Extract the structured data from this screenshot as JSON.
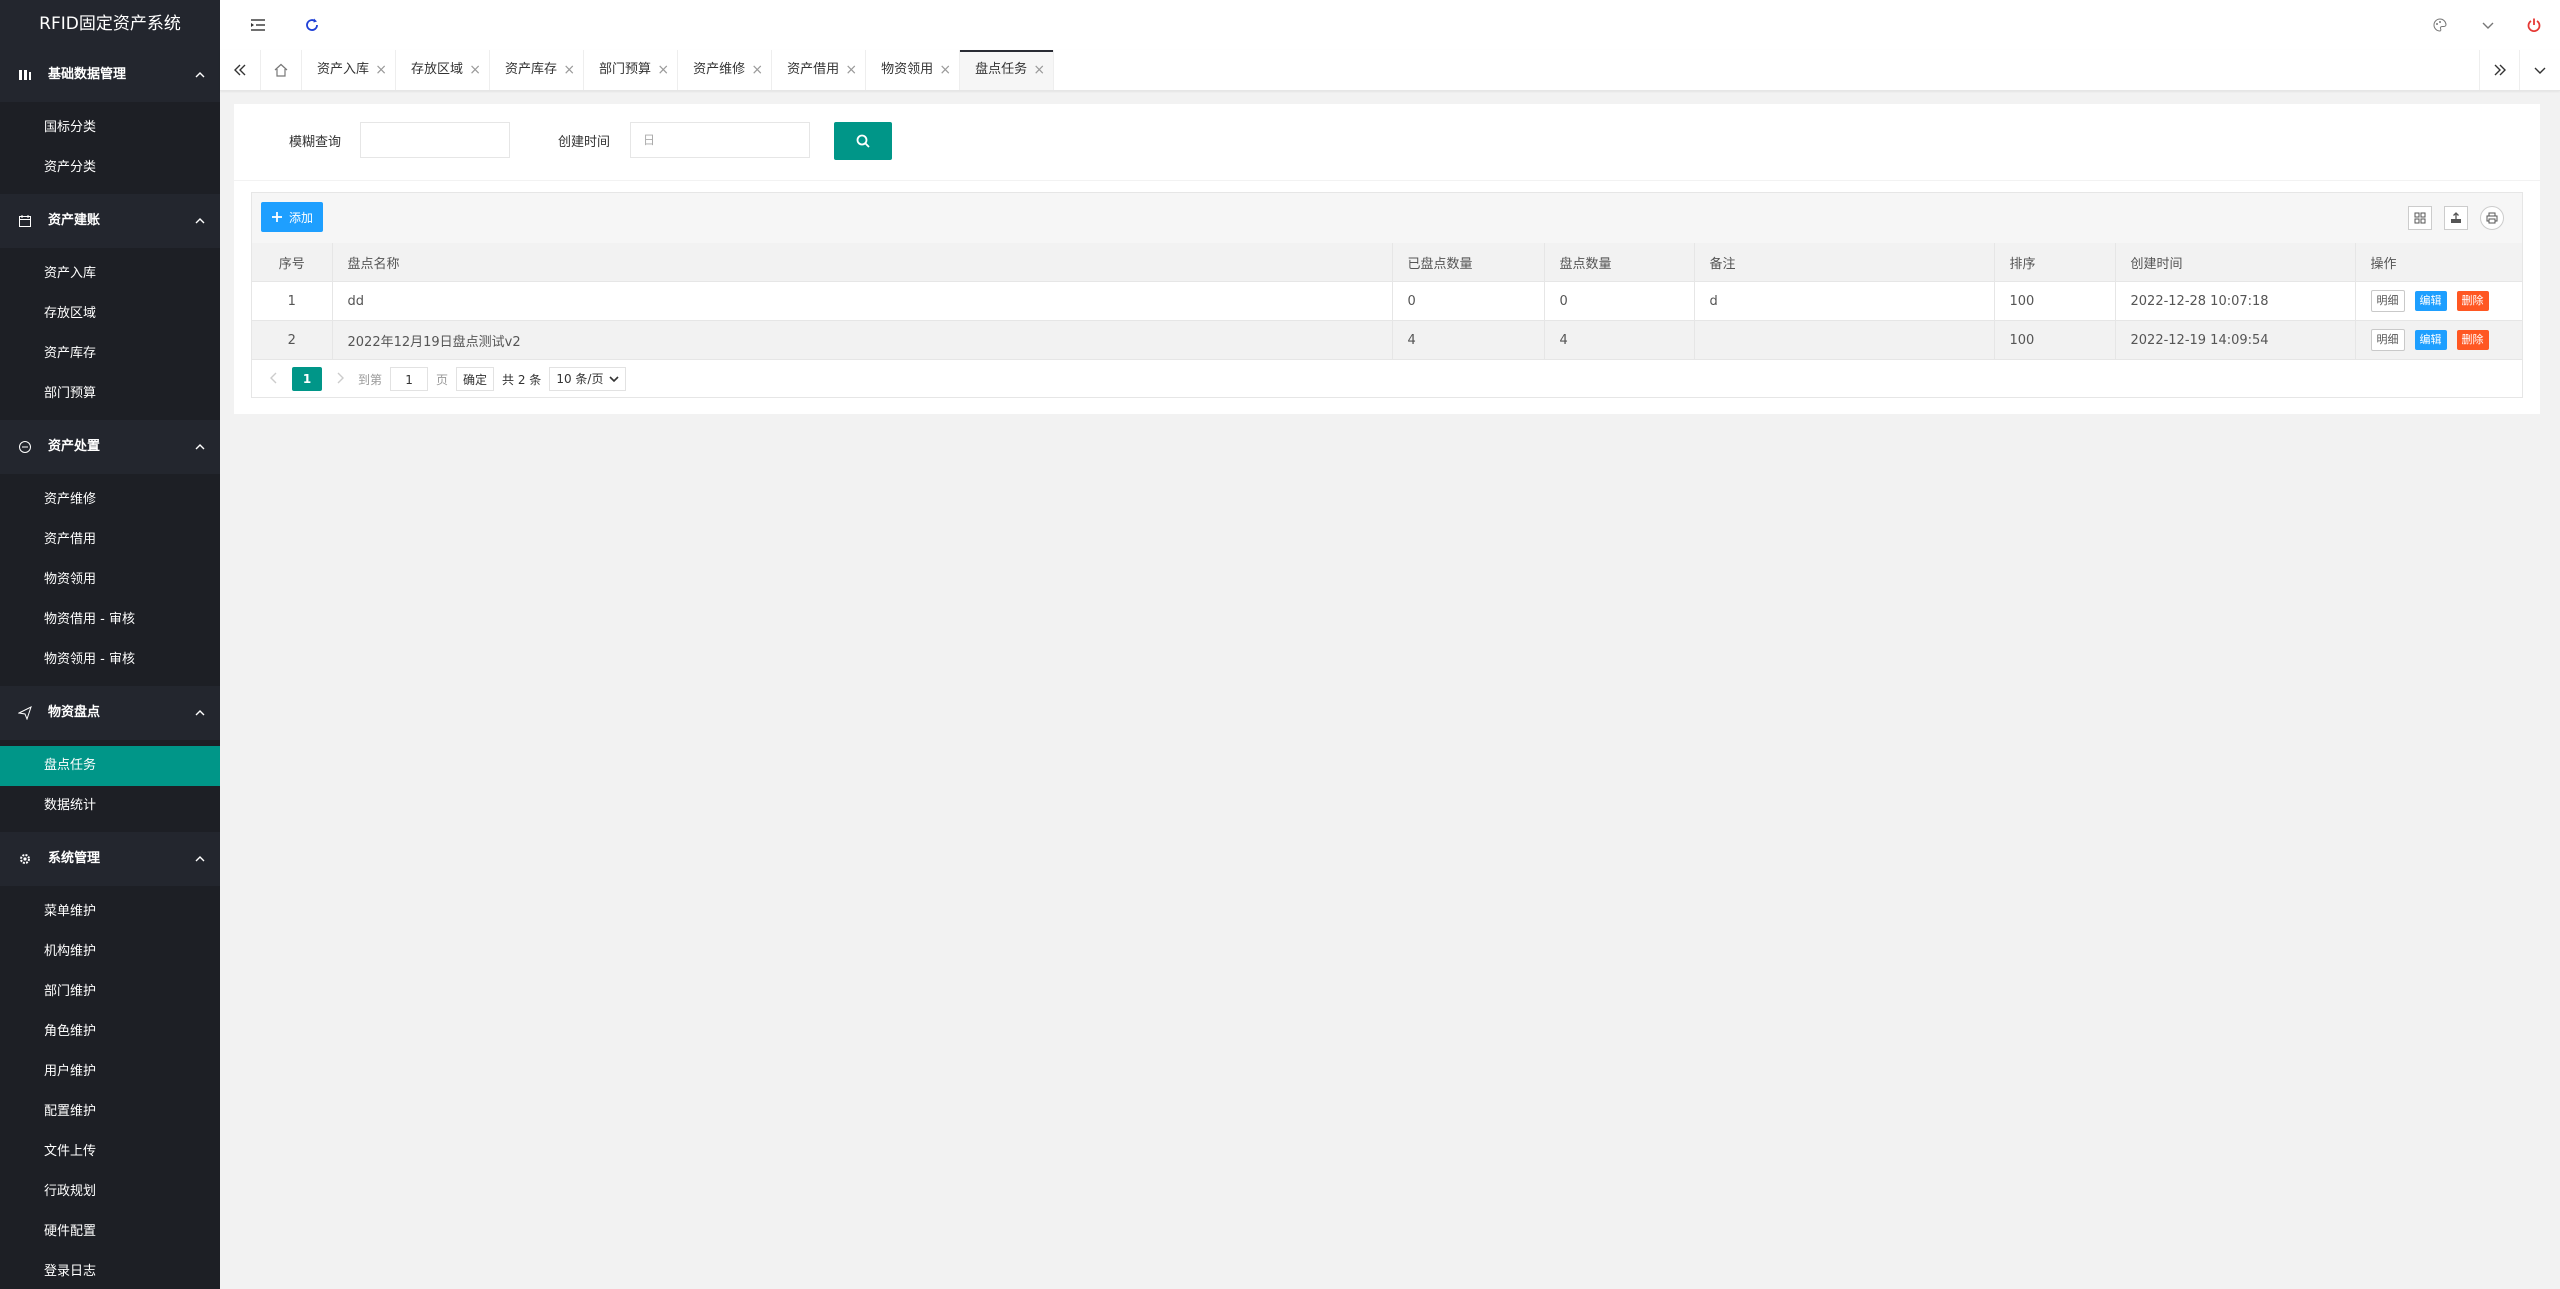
{
  "app": {
    "title": "RFID固定资产系统"
  },
  "sidebar": {
    "groups": [
      {
        "label": "基础数据管理",
        "items": [
          "国标分类",
          "资产分类"
        ]
      },
      {
        "label": "资产建账",
        "items": [
          "资产入库",
          "存放区域",
          "资产库存",
          "部门预算"
        ]
      },
      {
        "label": "资产处置",
        "items": [
          "资产维修",
          "资产借用",
          "物资领用",
          "物资借用 - 审核",
          "物资领用 - 审核"
        ]
      },
      {
        "label": "物资盘点",
        "items": [
          "盘点任务",
          "数据统计"
        ]
      },
      {
        "label": "系统管理",
        "items": [
          "菜单维护",
          "机构维护",
          "部门维护",
          "角色维护",
          "用户维护",
          "配置维护",
          "文件上传",
          "行政规划",
          "硬件配置",
          "登录日志"
        ]
      }
    ],
    "active_item": "盘点任务"
  },
  "tabs": [
    "资产入库",
    "存放区域",
    "资产库存",
    "部门预算",
    "资产维修",
    "资产借用",
    "物资领用",
    "盘点任务"
  ],
  "active_tab": "盘点任务",
  "search": {
    "fuzzy_label": "模糊查询",
    "fuzzy_value": "",
    "created_label": "创建时间",
    "created_placeholder": "日"
  },
  "toolbar": {
    "add_label": "添加"
  },
  "table": {
    "columns": [
      "序号",
      "盘点名称",
      "已盘点数量",
      "盘点数量",
      "备注",
      "排序",
      "创建时间",
      "操作"
    ],
    "rows": [
      [
        "1",
        "dd",
        "0",
        "0",
        "d",
        "100",
        "2022-12-28 10:07:18"
      ],
      [
        "2",
        "2022年12月19日盘点测试v2",
        "4",
        "4",
        "",
        "100",
        "2022-12-19 14:09:54"
      ]
    ],
    "actions": {
      "detail": "明细",
      "edit": "编辑",
      "delete": "删除"
    }
  },
  "pager": {
    "current": "1",
    "goto_prefix": "到第",
    "goto_value": "1",
    "goto_suffix": "页",
    "confirm": "确定",
    "total": "共 2 条",
    "page_size": "10 条/页"
  },
  "colors": {
    "primary": "#009688",
    "blue": "#1e9fff",
    "danger": "#ff5722",
    "sidebar": "#1d1f25"
  }
}
